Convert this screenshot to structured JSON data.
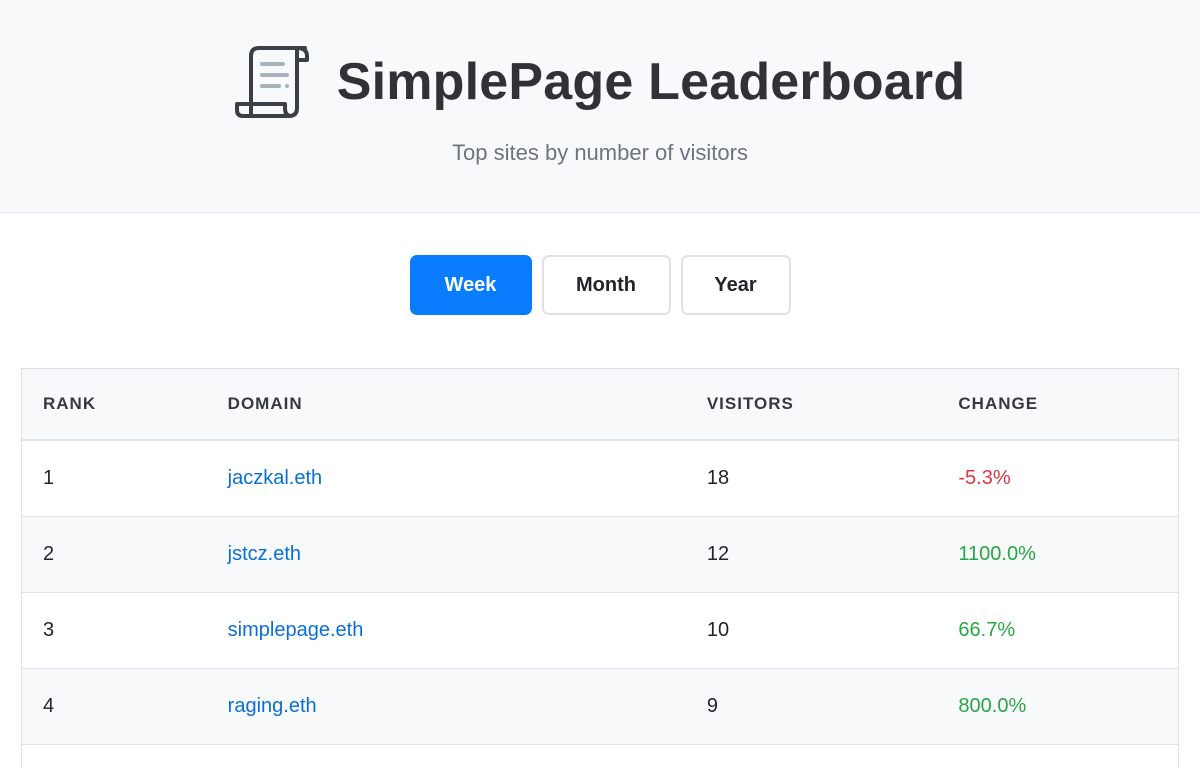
{
  "header": {
    "title": "SimplePage Leaderboard",
    "subtitle": "Top sites by number of visitors",
    "logo_icon": "scroll-icon"
  },
  "tabs": [
    {
      "label": "Week",
      "active": true
    },
    {
      "label": "Month",
      "active": false
    },
    {
      "label": "Year",
      "active": false
    }
  ],
  "table": {
    "columns": [
      "RANK",
      "DOMAIN",
      "VISITORS",
      "CHANGE"
    ],
    "rows": [
      {
        "rank": "1",
        "domain": "jaczkal.eth",
        "visitors": "18",
        "change": "-5.3%",
        "trend": "negative"
      },
      {
        "rank": "2",
        "domain": "jstcz.eth",
        "visitors": "12",
        "change": "1100.0%",
        "trend": "positive"
      },
      {
        "rank": "3",
        "domain": "simplepage.eth",
        "visitors": "10",
        "change": "66.7%",
        "trend": "positive"
      },
      {
        "rank": "4",
        "domain": "raging.eth",
        "visitors": "9",
        "change": "800.0%",
        "trend": "positive"
      }
    ]
  },
  "colors": {
    "accent": "#0a7cff",
    "link": "#0a6fd8",
    "negative": "#dc3545",
    "positive": "#28a745"
  }
}
